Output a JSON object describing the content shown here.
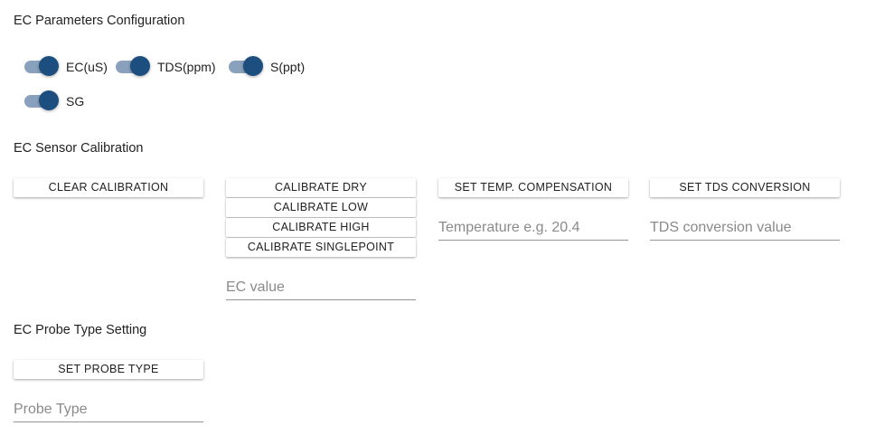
{
  "sections": {
    "params_title": "EC Parameters Configuration",
    "calibration_title": "EC Sensor Calibration",
    "probe_title": "EC Probe Type Setting"
  },
  "toggles": [
    {
      "label": "EC(uS)",
      "checked": true
    },
    {
      "label": "TDS(ppm)",
      "checked": true
    },
    {
      "label": "S(ppt)",
      "checked": true
    },
    {
      "label": "SG",
      "checked": true
    }
  ],
  "buttons": {
    "clear_calibration": "CLEAR CALIBRATION",
    "calibrate_dry": "CALIBRATE DRY",
    "calibrate_low": "CALIBRATE LOW",
    "calibrate_high": "CALIBRATE HIGH",
    "calibrate_singlepoint": "CALIBRATE SINGLEPOINT",
    "set_temp_compensation": "SET TEMP. COMPENSATION",
    "set_tds_conversion": "SET TDS CONVERSION",
    "set_probe_type": "SET PROBE TYPE"
  },
  "inputs": {
    "temperature": {
      "placeholder": "Temperature e.g. 20.4",
      "value": ""
    },
    "tds_conversion": {
      "placeholder": "TDS conversion value",
      "value": ""
    },
    "ec_value": {
      "placeholder": "EC value",
      "value": ""
    },
    "probe_type": {
      "placeholder": "Probe Type",
      "value": ""
    }
  },
  "colors": {
    "toggle_track": "#8aa1bd",
    "toggle_thumb": "#1c4e80"
  }
}
